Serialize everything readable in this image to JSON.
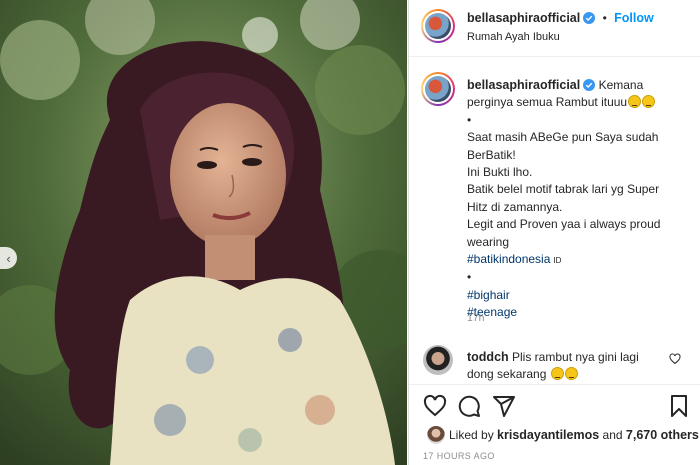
{
  "post": {
    "username": "bellasaphiraofficial",
    "follow_label": "Follow",
    "dot": "•",
    "location": "Rumah Ayah Ibuku",
    "prev_icon": "chevron-left-icon"
  },
  "caption": {
    "username": "bellasaphiraofficial",
    "first_text": "Kemana",
    "line2": "perginya semua Rambut ituuu",
    "line3": "•",
    "line4": "Saat masih ABeGe pun Saya sudah",
    "line5": "BerBatik!",
    "line6": "Ini Bukti lho.",
    "line7": "Batik belel motif tabrak lari yg Super",
    "line8": "Hitz di zamannya.",
    "line9": "Legit and Proven yaa i always proud",
    "line10": "wearing",
    "hashtag1": "#batikindonesia",
    "flag": "ID",
    "line12": "•",
    "hashtag2": "#bighair",
    "hashtag3": "#teenage",
    "time": "17h"
  },
  "comment": {
    "username": "toddch",
    "text1": "Plis rambut nya gini lagi",
    "text2": "dong sekarang"
  },
  "likes": {
    "prefix": "Liked by",
    "user": "krisdayantilemos",
    "middle": "and",
    "count": "7,670 others"
  },
  "posted": "17 HOURS AGO",
  "colors": {
    "accent": "#0095f6",
    "text": "#262626",
    "muted": "#8e8e8e",
    "hashtag": "#00376b"
  }
}
